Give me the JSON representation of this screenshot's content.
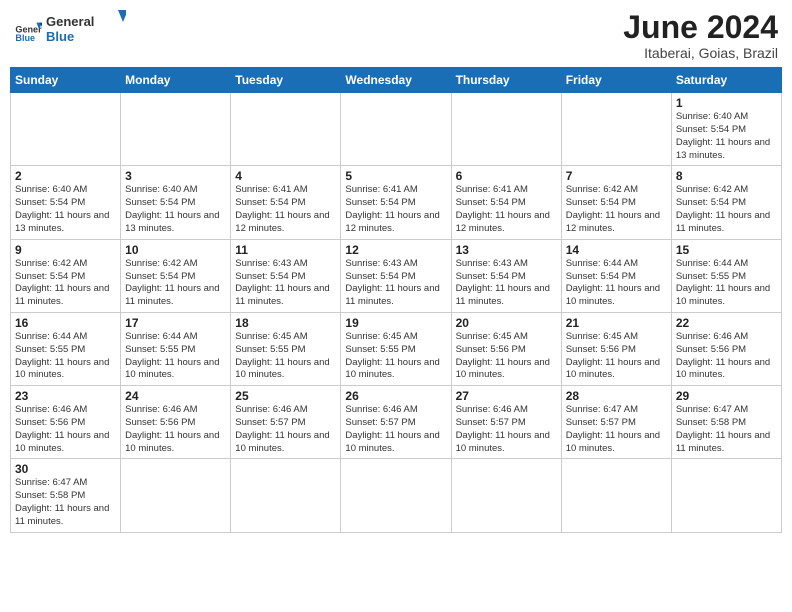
{
  "header": {
    "logo_general": "General",
    "logo_blue": "Blue",
    "month_title": "June 2024",
    "location": "Itaberai, Goias, Brazil"
  },
  "weekdays": [
    "Sunday",
    "Monday",
    "Tuesday",
    "Wednesday",
    "Thursday",
    "Friday",
    "Saturday"
  ],
  "days": {
    "1": {
      "sunrise": "6:40 AM",
      "sunset": "5:54 PM",
      "daylight": "11 hours and 13 minutes."
    },
    "2": {
      "sunrise": "6:40 AM",
      "sunset": "5:54 PM",
      "daylight": "11 hours and 13 minutes."
    },
    "3": {
      "sunrise": "6:40 AM",
      "sunset": "5:54 PM",
      "daylight": "11 hours and 13 minutes."
    },
    "4": {
      "sunrise": "6:41 AM",
      "sunset": "5:54 PM",
      "daylight": "11 hours and 12 minutes."
    },
    "5": {
      "sunrise": "6:41 AM",
      "sunset": "5:54 PM",
      "daylight": "11 hours and 12 minutes."
    },
    "6": {
      "sunrise": "6:41 AM",
      "sunset": "5:54 PM",
      "daylight": "11 hours and 12 minutes."
    },
    "7": {
      "sunrise": "6:42 AM",
      "sunset": "5:54 PM",
      "daylight": "11 hours and 12 minutes."
    },
    "8": {
      "sunrise": "6:42 AM",
      "sunset": "5:54 PM",
      "daylight": "11 hours and 11 minutes."
    },
    "9": {
      "sunrise": "6:42 AM",
      "sunset": "5:54 PM",
      "daylight": "11 hours and 11 minutes."
    },
    "10": {
      "sunrise": "6:42 AM",
      "sunset": "5:54 PM",
      "daylight": "11 hours and 11 minutes."
    },
    "11": {
      "sunrise": "6:43 AM",
      "sunset": "5:54 PM",
      "daylight": "11 hours and 11 minutes."
    },
    "12": {
      "sunrise": "6:43 AM",
      "sunset": "5:54 PM",
      "daylight": "11 hours and 11 minutes."
    },
    "13": {
      "sunrise": "6:43 AM",
      "sunset": "5:54 PM",
      "daylight": "11 hours and 11 minutes."
    },
    "14": {
      "sunrise": "6:44 AM",
      "sunset": "5:54 PM",
      "daylight": "11 hours and 10 minutes."
    },
    "15": {
      "sunrise": "6:44 AM",
      "sunset": "5:55 PM",
      "daylight": "11 hours and 10 minutes."
    },
    "16": {
      "sunrise": "6:44 AM",
      "sunset": "5:55 PM",
      "daylight": "11 hours and 10 minutes."
    },
    "17": {
      "sunrise": "6:44 AM",
      "sunset": "5:55 PM",
      "daylight": "11 hours and 10 minutes."
    },
    "18": {
      "sunrise": "6:45 AM",
      "sunset": "5:55 PM",
      "daylight": "11 hours and 10 minutes."
    },
    "19": {
      "sunrise": "6:45 AM",
      "sunset": "5:55 PM",
      "daylight": "11 hours and 10 minutes."
    },
    "20": {
      "sunrise": "6:45 AM",
      "sunset": "5:56 PM",
      "daylight": "11 hours and 10 minutes."
    },
    "21": {
      "sunrise": "6:45 AM",
      "sunset": "5:56 PM",
      "daylight": "11 hours and 10 minutes."
    },
    "22": {
      "sunrise": "6:46 AM",
      "sunset": "5:56 PM",
      "daylight": "11 hours and 10 minutes."
    },
    "23": {
      "sunrise": "6:46 AM",
      "sunset": "5:56 PM",
      "daylight": "11 hours and 10 minutes."
    },
    "24": {
      "sunrise": "6:46 AM",
      "sunset": "5:56 PM",
      "daylight": "11 hours and 10 minutes."
    },
    "25": {
      "sunrise": "6:46 AM",
      "sunset": "5:57 PM",
      "daylight": "11 hours and 10 minutes."
    },
    "26": {
      "sunrise": "6:46 AM",
      "sunset": "5:57 PM",
      "daylight": "11 hours and 10 minutes."
    },
    "27": {
      "sunrise": "6:46 AM",
      "sunset": "5:57 PM",
      "daylight": "11 hours and 10 minutes."
    },
    "28": {
      "sunrise": "6:47 AM",
      "sunset": "5:57 PM",
      "daylight": "11 hours and 10 minutes."
    },
    "29": {
      "sunrise": "6:47 AM",
      "sunset": "5:58 PM",
      "daylight": "11 hours and 11 minutes."
    },
    "30": {
      "sunrise": "6:47 AM",
      "sunset": "5:58 PM",
      "daylight": "11 hours and 11 minutes."
    }
  }
}
